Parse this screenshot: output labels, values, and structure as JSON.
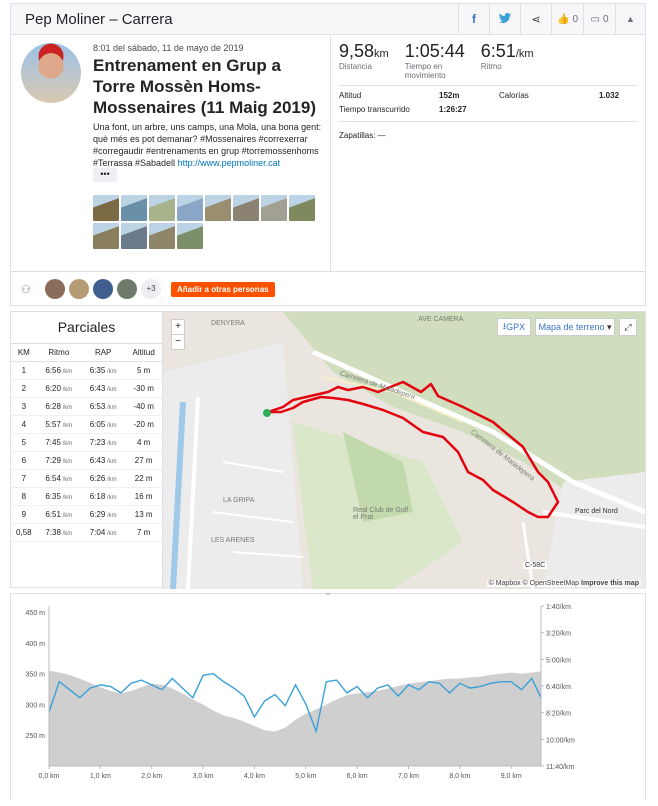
{
  "header": {
    "title": "Pep Moliner – Carrera",
    "actions": [
      "facebook-icon",
      "twitter-icon",
      "share-icon"
    ],
    "kudos_count": "0",
    "comments_count": "0"
  },
  "activity": {
    "date": "8:01 del sábado, 11 de mayo de 2019",
    "title": "Entrenament en Grup a Torre Mossèn Homs-Mossenaires (11 Maig 2019)",
    "description": "Una font, un arbre, uns camps, una Mola, una bona gent: què més es pot demanar? #Mossenaires #correxerrar #corregaudir #entrenaments en grup #torremossenhoms #Terrassa #Sabadell",
    "link": "http://www.pepmoliner.cat",
    "more_label": "•••",
    "photo_colors": [
      "#7c6a44",
      "#6a8fa8",
      "#a7b48b",
      "#8aa6c6",
      "#9a8e70",
      "#8b8272",
      "#a2a092",
      "#7e8a5e",
      "#8a7f5c",
      "#6b7a8a",
      "#8f866a",
      "#7d8f6a"
    ],
    "people_colors": [
      "#8a6d5a",
      "#b59b74",
      "#3f5f8f",
      "#6f7b6a"
    ],
    "people_more": "+3",
    "add_others_label": "Añadir a otras personas"
  },
  "stats": {
    "distance": {
      "value": "9,58",
      "unit": "km",
      "label": "Distancia"
    },
    "moving_time": {
      "value": "1:05:44",
      "label": "Tiempo en movimiento"
    },
    "pace": {
      "value": "6:51",
      "unit": "/km",
      "label": "Ritmo"
    },
    "elevation_label": "Altitud",
    "elevation_value": "152m",
    "calories_label": "Calorías",
    "calories_value": "1.032",
    "elapsed_label": "Tiempo transcurrido",
    "elapsed_value": "1:26:27",
    "shoes": "Zapatillas: —"
  },
  "splits": {
    "title": "Parciales",
    "headers": [
      "KM",
      "Ritmo",
      "RAP",
      "Altitud"
    ],
    "unit": "/km",
    "rows": [
      [
        "1",
        "6:56",
        "6:35",
        "5 m"
      ],
      [
        "2",
        "6:20",
        "6:43",
        "-30 m"
      ],
      [
        "3",
        "6:28",
        "6:53",
        "-40 m"
      ],
      [
        "4",
        "5:57",
        "6:05",
        "-20 m"
      ],
      [
        "5",
        "7:45",
        "7:23",
        "4 m"
      ],
      [
        "6",
        "7:29",
        "6:43",
        "27 m"
      ],
      [
        "7",
        "6:54",
        "6:26",
        "22 m"
      ],
      [
        "8",
        "6:35",
        "6:18",
        "16 m"
      ],
      [
        "9",
        "6:51",
        "6:29",
        "13 m"
      ],
      [
        "0,58",
        "7:38",
        "7:04",
        "7 m"
      ]
    ]
  },
  "map": {
    "zoom_in": "+",
    "zoom_out": "−",
    "gpx_label": "GPX",
    "map_type_label": "Mapa de terreno",
    "attribution": "© Mapbox © OpenStreetMap",
    "improve_label": "Improve this map",
    "labels": [
      "DENYERA",
      "Carretera de Matadepera",
      "Carretera de Matadepera",
      "Parc del Nord",
      "LA GRIPA",
      "LES ARENES",
      "Real Club de Golf el Prat",
      "AVE CAMERA",
      "C-58C"
    ]
  },
  "chart_data": {
    "type": "area",
    "x": [
      0.0,
      0.2,
      0.4,
      0.6,
      0.8,
      1.0,
      1.2,
      1.4,
      1.6,
      1.8,
      2.0,
      2.2,
      2.4,
      2.6,
      2.8,
      3.0,
      3.2,
      3.4,
      3.6,
      3.8,
      4.0,
      4.2,
      4.4,
      4.6,
      4.8,
      5.0,
      5.2,
      5.4,
      5.6,
      5.8,
      6.0,
      6.2,
      6.4,
      6.6,
      6.8,
      7.0,
      7.2,
      7.4,
      7.6,
      7.8,
      8.0,
      8.2,
      8.4,
      8.6,
      8.8,
      9.0,
      9.2,
      9.4,
      9.58
    ],
    "series": [
      {
        "values": [
          355,
          352,
          348,
          342,
          335,
          328,
          322,
          318,
          322,
          328,
          334,
          332,
          326,
          318,
          308,
          300,
          290,
          282,
          278,
          272,
          265,
          258,
          256,
          262,
          275,
          285,
          292,
          300,
          308,
          315,
          318,
          320,
          322,
          326,
          330,
          334,
          336,
          338,
          340,
          342,
          342,
          344,
          345,
          348,
          350,
          352,
          350,
          352,
          354
        ]
      },
      {
        "values": [
          8.3,
          6.4,
          6.9,
          7.4,
          6.8,
          6.6,
          6.7,
          7.1,
          6.5,
          6.3,
          6.6,
          6.9,
          6.2,
          6.8,
          7.4,
          6.0,
          5.9,
          6.4,
          6.8,
          7.3,
          8.6,
          7.6,
          7.2,
          7.9,
          6.6,
          7.8,
          9.5,
          6.4,
          6.3,
          7.1,
          6.7,
          7.4,
          6.8,
          6.6,
          7.3,
          6.6,
          6.9,
          6.4,
          6.5,
          7.1,
          6.5,
          6.8,
          6.7,
          6.5,
          6.4,
          6.4,
          6.9,
          6.2,
          7.4
        ]
      }
    ],
    "xlabel": "",
    "ylabel": "",
    "xticks": [
      "0,0 km",
      "1,0 km",
      "2,0 km",
      "3,0 km",
      "4,0 km",
      "5,0 km",
      "6,0 km",
      "7,0 km",
      "8,0 km",
      "9,0 km"
    ],
    "yticks_left": [
      "450 m",
      "400 m",
      "350 m",
      "300 m",
      "250 m"
    ],
    "yticks_right": [
      "1:40/km",
      "3:20/km",
      "5:00/km",
      "6:40/km",
      "8:20/km",
      "10:00/km",
      "11:40/km"
    ],
    "ylim": [
      200,
      460
    ],
    "grid": false,
    "colors": {
      "elevation": "#cfcfcf",
      "pace": "#3aa0d8"
    }
  }
}
